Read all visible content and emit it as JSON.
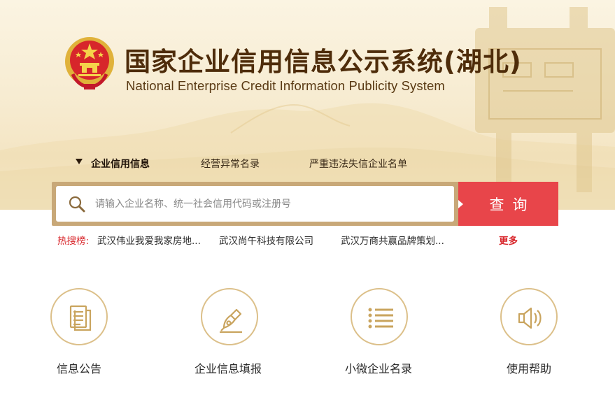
{
  "header": {
    "title_cn": "国家企业信用信息公示系统(湖北)",
    "title_en": "National Enterprise Credit Information Publicity System"
  },
  "tabs": [
    {
      "label": "企业信用信息",
      "active": true
    },
    {
      "label": "经营异常名录",
      "active": false
    },
    {
      "label": "严重违法失信企业名单",
      "active": false
    }
  ],
  "search": {
    "placeholder": "请输入企业名称、统一社会信用代码或注册号",
    "value": "",
    "button_label": "查询"
  },
  "hot_search": {
    "label": "热搜榜:",
    "items": [
      "武汉伟业我爱我家房地...",
      "武汉尚午科技有限公司",
      "武汉万商共赢品牌策划..."
    ],
    "more_label": "更多"
  },
  "functions": [
    {
      "label": "信息公告",
      "icon": "document-icon"
    },
    {
      "label": "企业信息填报",
      "icon": "pen-icon"
    },
    {
      "label": "小微企业名录",
      "icon": "list-icon"
    },
    {
      "label": "使用帮助",
      "icon": "speaker-icon"
    }
  ],
  "colors": {
    "accent_red": "#e8454a",
    "hot_red": "#d8262b",
    "gold": "#dcc08a",
    "search_frame": "#c8a878",
    "title_brown": "#4e2c0a"
  }
}
